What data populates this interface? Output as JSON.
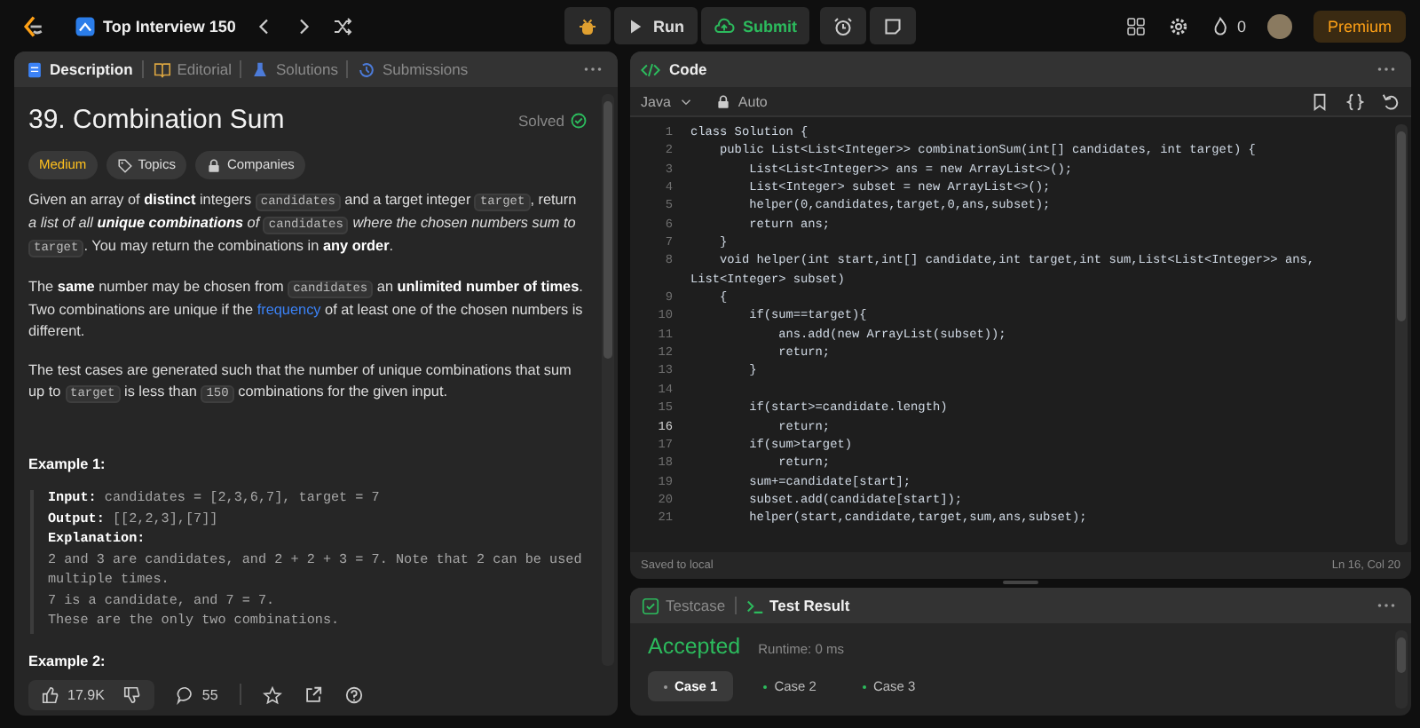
{
  "top_bar": {
    "list_title": "Top Interview 150",
    "run": "Run",
    "submit": "Submit",
    "streak": "0",
    "premium": "Premium"
  },
  "description_panel": {
    "tabs": [
      {
        "label": "Description",
        "selected": true
      },
      {
        "label": "Editorial",
        "selected": false
      },
      {
        "label": "Solutions",
        "selected": false
      },
      {
        "label": "Submissions",
        "selected": false
      }
    ],
    "title": "39. Combination Sum",
    "status": "Solved",
    "tags": [
      {
        "label": "Medium",
        "kind": "difficulty"
      },
      {
        "label": "Topics",
        "kind": "topics"
      },
      {
        "label": "Companies",
        "kind": "companies"
      }
    ],
    "paragraphs": [
      [
        {
          "kind": "plain",
          "text": "Given an array of **distinct** integers "
        },
        {
          "kind": "code",
          "text": "candidates"
        },
        {
          "kind": "plain",
          "text": " and a target integer "
        },
        {
          "kind": "code",
          "text": "target"
        },
        {
          "kind": "plain",
          "text": ", return "
        },
        {
          "kind": "italic",
          "text": "a list of all **unique combinations** of "
        },
        {
          "kind": "code",
          "text": "candidates"
        },
        {
          "kind": "italic",
          "text": " where the chosen numbers sum to "
        },
        {
          "kind": "code",
          "text": "target"
        },
        {
          "kind": "plain",
          "text": ". You may return the combinations in **any order**."
        }
      ],
      [
        {
          "kind": "plain",
          "text": "The **same** number may be chosen from "
        },
        {
          "kind": "code",
          "text": "candidates"
        },
        {
          "kind": "plain",
          "text": " an **unlimited number of times**. Two combinations are unique if the "
        },
        {
          "kind": "link",
          "text": "frequency"
        },
        {
          "kind": "plain",
          "text": " of at least one of the chosen numbers is different."
        }
      ],
      [
        {
          "kind": "plain",
          "text": "The test cases are generated such that the number of unique combinations that sum up to "
        },
        {
          "kind": "code",
          "text": "target"
        },
        {
          "kind": "plain",
          "text": " is less than "
        },
        {
          "kind": "code",
          "text": "150"
        },
        {
          "kind": "plain",
          "text": " combinations for the given input."
        }
      ]
    ],
    "examples": [
      {
        "heading": "Example 1:",
        "lines": [
          {
            "label": "Input:",
            "text": "candidates = [2,3,6,7], target = 7"
          },
          {
            "label": "Output:",
            "text": "[[2,2,3],[7]]"
          },
          {
            "label": "Explanation:"
          },
          {
            "text": "2 and 3 are candidates, and 2 + 2 + 3 = 7. Note that 2 can be used multiple times."
          },
          {
            "text": "7 is a candidate, and 7 = 7."
          },
          {
            "text": "These are the only two combinations."
          }
        ]
      },
      {
        "heading": "Example 2:"
      }
    ],
    "footer": {
      "likes": "17.9K",
      "comments": "55"
    }
  },
  "code_panel": {
    "title": "Code",
    "language": "Java",
    "mode": "Auto",
    "lines": [
      {
        "number": "1",
        "text": "class Solution {",
        "current": false
      },
      {
        "number": "2",
        "text": "    public List<List<Integer>> combinationSum(int[] candidates, int target) {",
        "current": false
      },
      {
        "number": "3",
        "text": "        List<List<Integer>> ans = new ArrayList<>();",
        "current": false
      },
      {
        "number": "4",
        "text": "        List<Integer> subset = new ArrayList<>();",
        "current": false
      },
      {
        "number": "5",
        "text": "        helper(0,candidates,target,0,ans,subset);",
        "current": false
      },
      {
        "number": "6",
        "text": "        return ans;",
        "current": false
      },
      {
        "number": "7",
        "text": "    }",
        "current": false
      },
      {
        "number": "8",
        "text": "    void helper(int start,int[] candidate,int target,int sum,List<List<Integer>> ans,",
        "continuation": "List<Integer> subset)",
        "current": false
      },
      {
        "number": "9",
        "text": "    {",
        "current": false
      },
      {
        "number": "10",
        "text": "        if(sum==target){",
        "current": false
      },
      {
        "number": "11",
        "text": "            ans.add(new ArrayList(subset));",
        "current": false
      },
      {
        "number": "12",
        "text": "            return;",
        "current": false
      },
      {
        "number": "13",
        "text": "        }",
        "current": false
      },
      {
        "number": "14",
        "current": false
      },
      {
        "number": "15",
        "text": "        if(start>=candidate.length)",
        "current": false
      },
      {
        "number": "16",
        "text": "            return;",
        "current": true
      },
      {
        "number": "17",
        "text": "        if(sum>target)",
        "current": false
      },
      {
        "number": "18",
        "text": "            return;",
        "current": false
      },
      {
        "number": "19",
        "text": "        sum+=candidate[start];",
        "current": false
      },
      {
        "number": "20",
        "text": "        subset.add(candidate[start]);",
        "current": false
      },
      {
        "number": "21",
        "text": "        helper(start,candidate,target,sum,ans,subset);",
        "current": false
      }
    ],
    "saved": "Saved to local",
    "cursor": "Ln 16, Col 20"
  },
  "result_panel": {
    "tabs": [
      {
        "label": "Testcase",
        "selected": false
      },
      {
        "label": "Test Result",
        "selected": true
      }
    ],
    "verdict": "Accepted",
    "runtime": "Runtime: 0 ms",
    "cases": [
      {
        "label": "Case 1",
        "selected": true
      },
      {
        "label": "Case 2",
        "selected": false
      },
      {
        "label": "Case 3",
        "selected": false
      }
    ]
  }
}
